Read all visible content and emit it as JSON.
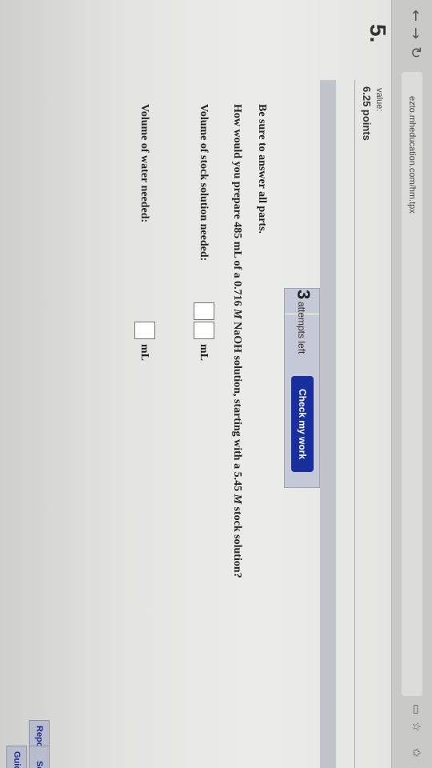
{
  "browser": {
    "url": "ezto.mheducation.com/hm.tpx"
  },
  "question": {
    "number": "5.",
    "value_label": "value:",
    "points": "6.25 points"
  },
  "attempts": {
    "count": "3",
    "label": "attempts left",
    "check_button": "Check my work"
  },
  "content": {
    "instruction": "Be sure to answer all parts.",
    "prompt_parts": [
      "How would you prepare 485 mL of a 0.716 ",
      "M",
      " NaOH solution, starting with a 5.45 ",
      "M",
      " stock solution?"
    ],
    "fields": [
      {
        "label": "Volume of stock solution needed:",
        "value": "",
        "unit": "mL"
      },
      {
        "label": "Volume of water needed:",
        "value": "",
        "unit": "mL"
      }
    ]
  },
  "sidebar_buttons": {
    "report": "Report",
    "second": "Sc",
    "guide": "Guid"
  },
  "colors": {
    "check_button_bg": "#1a2f9e",
    "attempts_bg": "#c5c8d6"
  }
}
